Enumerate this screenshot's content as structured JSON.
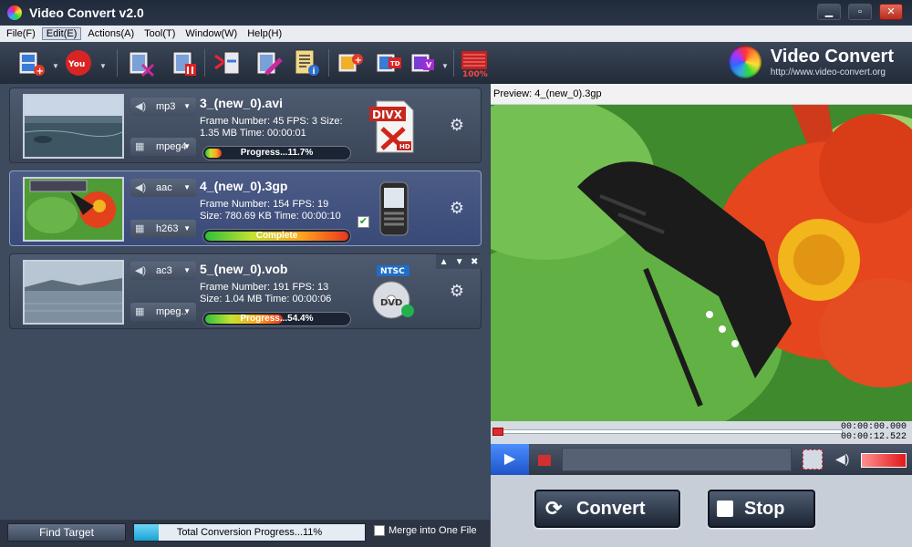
{
  "window": {
    "title": "Video Convert v2.0",
    "minimize": "▁",
    "maximize": "▫",
    "close": "✕"
  },
  "menu": [
    {
      "label": "File(F)"
    },
    {
      "label": "Edit(E)"
    },
    {
      "label": "Actions(A)"
    },
    {
      "label": "Tool(T)"
    },
    {
      "label": "Window(W)"
    },
    {
      "label": "Help(H)"
    }
  ],
  "brand": {
    "name": "Video Convert",
    "url": "http://www.video-convert.org"
  },
  "toolbar": {
    "zoom_label": "100%"
  },
  "items": [
    {
      "audio_codec": "mp3",
      "video_codec": "mpeg4",
      "filename": "3_(new_0).avi",
      "info": "Frame Number: 45 FPS: 3 Size: 1.35 MB Time: 00:00:01",
      "progress_text": "Progress...11.7%",
      "progress": 0.117,
      "format_label": "DIVX",
      "format_sub": "HD",
      "thumb": "lake-scene"
    },
    {
      "audio_codec": "aac",
      "video_codec": "h263",
      "filename": "4_(new_0).3gp",
      "info": "Frame Number: 154 FPS: 19 Size: 780.69 KB Time: 00:00:10",
      "progress_text": "Complete",
      "progress": 1.0,
      "format_label": "phone",
      "thumb": "flower-scene"
    },
    {
      "audio_codec": "ac3",
      "video_codec": "mpeg..",
      "filename": "5_(new_0).vob",
      "info": "Frame Number: 191 FPS: 13 Size: 1.04 MB Time: 00:00:06",
      "progress_text": "Progress...54.4%",
      "progress": 0.544,
      "format_label": "NTSC",
      "format_sub": "DVD",
      "thumb": "lake-scene-2"
    }
  ],
  "preview": {
    "label": "Preview: 4_(new_0).3gp",
    "time_current": "00:00:00.000",
    "time_total": "00:00:12.522"
  },
  "actions": {
    "convert": "Convert",
    "stop": "Stop"
  },
  "status": {
    "find_target": "Find Target",
    "total_progress_text": "Total Conversion Progress...11%",
    "total_progress": 0.11,
    "merge_label": "Merge into One File"
  },
  "colors": {
    "accent_red": "#e02a2a",
    "progress_blue": "#1aa3d6",
    "selected_item": "#4c5c86"
  }
}
